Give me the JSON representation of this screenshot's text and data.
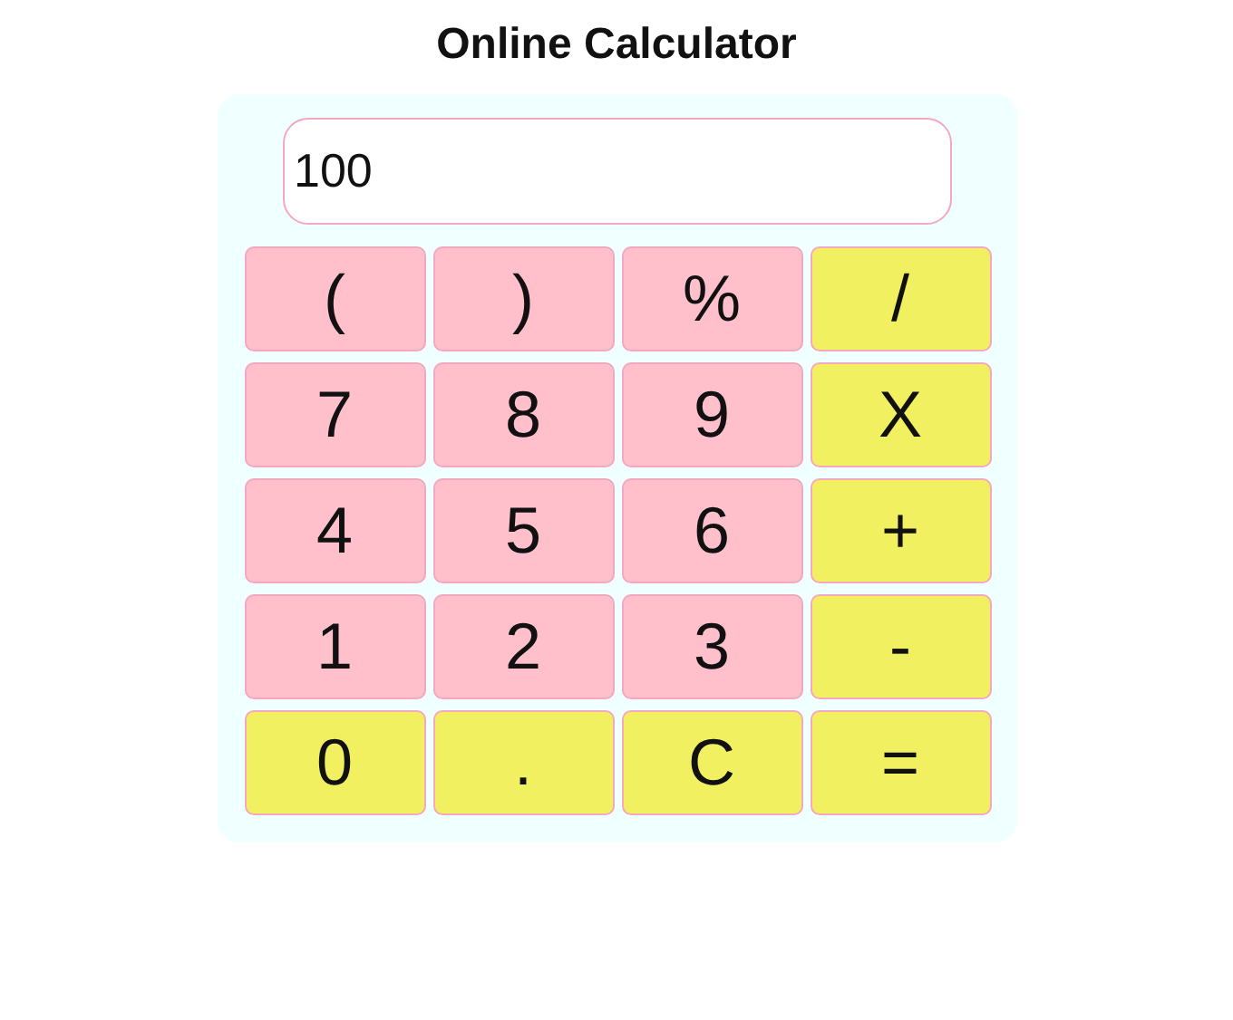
{
  "title": "Online Calculator",
  "display": {
    "value": "100"
  },
  "keys": [
    {
      "label": "(",
      "kind": "digit"
    },
    {
      "label": ")",
      "kind": "digit"
    },
    {
      "label": "%",
      "kind": "digit"
    },
    {
      "label": "/",
      "kind": "op"
    },
    {
      "label": "7",
      "kind": "digit"
    },
    {
      "label": "8",
      "kind": "digit"
    },
    {
      "label": "9",
      "kind": "digit"
    },
    {
      "label": "X",
      "kind": "op"
    },
    {
      "label": "4",
      "kind": "digit"
    },
    {
      "label": "5",
      "kind": "digit"
    },
    {
      "label": "6",
      "kind": "digit"
    },
    {
      "label": "+",
      "kind": "op"
    },
    {
      "label": "1",
      "kind": "digit"
    },
    {
      "label": "2",
      "kind": "digit"
    },
    {
      "label": "3",
      "kind": "digit"
    },
    {
      "label": "-",
      "kind": "op"
    },
    {
      "label": "0",
      "kind": "op"
    },
    {
      "label": ".",
      "kind": "op"
    },
    {
      "label": "C",
      "kind": "op"
    },
    {
      "label": "=",
      "kind": "op"
    }
  ]
}
